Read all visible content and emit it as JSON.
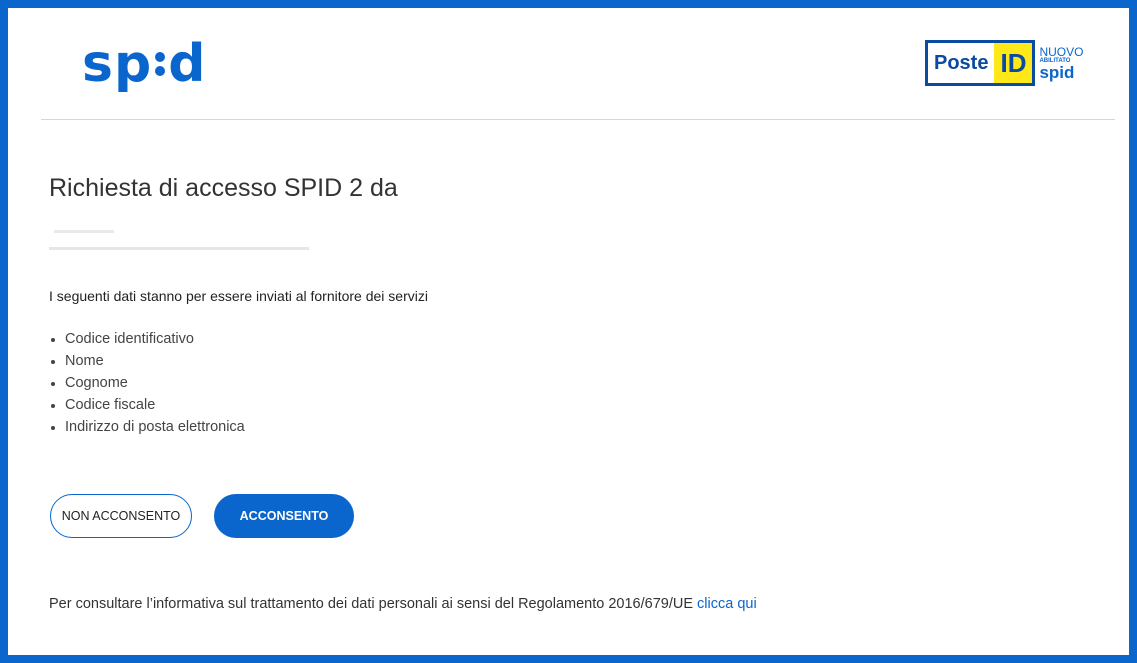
{
  "header": {
    "logo": "spid",
    "brand": {
      "poste": "Poste",
      "id": "ID",
      "nuovo": "NUOVO",
      "abilitato": "ABILITATO",
      "spid": "spid"
    }
  },
  "main": {
    "title": "Richiesta di accesso SPID 2 da",
    "intro": "I seguenti dati stanno per essere inviati al fornitore dei servizi",
    "attributes": [
      "Codice identificativo",
      "Nome",
      "Cognome",
      "Codice fiscale",
      "Indirizzo di posta elettronica"
    ],
    "buttons": {
      "deny": "NON ACCONSENTO",
      "accept": "ACCONSENTO"
    },
    "privacy": {
      "text": "Per consultare l’informativa sul trattamento dei dati personali ai sensi del Regolamento 2016/679/UE ",
      "link": "clicca qui"
    }
  },
  "colors": {
    "accent": "#0a66cc",
    "yellow": "#ffe81a"
  }
}
